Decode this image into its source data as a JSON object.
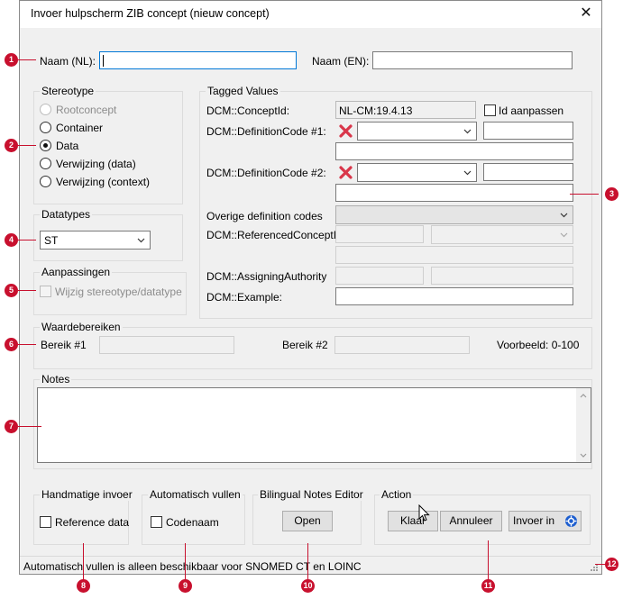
{
  "window": {
    "title": "Invoer hulpscherm ZIB concept (nieuw concept)",
    "close_glyph": "✕"
  },
  "naam": {
    "nl_label": "Naam (NL):",
    "en_label": "Naam (EN):",
    "nl_value": "",
    "en_value": ""
  },
  "stereotype": {
    "label": "Stereotype",
    "options": [
      "Rootconcept",
      "Container",
      "Data",
      "Verwijzing (data)",
      "Verwijzing (context)"
    ],
    "selected": "Data"
  },
  "datatypes": {
    "label": "Datatypes",
    "value": "ST"
  },
  "aanpassingen": {
    "label": "Aanpassingen",
    "checkbox_label": "Wijzig stereotype/datatype"
  },
  "tagged": {
    "label": "Tagged Values",
    "concept_id_label": "DCM::ConceptId:",
    "concept_id_value": "NL-CM:19.4.13",
    "id_aanpassen_label": "Id aanpassen",
    "def1_label": "DCM::DefinitionCode #1:",
    "def2_label": "DCM::DefinitionCode #2:",
    "overige_label": "Overige definition codes",
    "referenced_label": "DCM::ReferencedConceptId:",
    "assigning_label": "DCM::AssigningAuthority",
    "example_label": "DCM::Example:"
  },
  "waarde": {
    "label": "Waardebereiken",
    "bereik1_label": "Bereik #1",
    "bereik2_label": "Bereik #2",
    "voorbeeld": "Voorbeeld: 0-100"
  },
  "notes": {
    "label": "Notes"
  },
  "handmatig": {
    "label": "Handmatige invoer",
    "checkbox_label": "Reference data"
  },
  "automatisch": {
    "label": "Automatisch vullen",
    "checkbox_label": "Codenaam"
  },
  "bilingual": {
    "label": "Bilingual Notes Editor",
    "open_label": "Open"
  },
  "action": {
    "label": "Action",
    "klaar_label": "Klaar",
    "annuleer_label": "Annuleer",
    "invoer_label": "Invoer in"
  },
  "status": {
    "text": "Automatisch vullen is alleen beschikbaar voor SNOMED CT en LOINC"
  },
  "callouts": [
    "1",
    "2",
    "3",
    "4",
    "5",
    "6",
    "7",
    "8",
    "9",
    "10",
    "11",
    "12"
  ],
  "colors": {
    "callout": "#c8102e",
    "focus": "#0078d7",
    "window_bg": "#f0f0f0"
  }
}
